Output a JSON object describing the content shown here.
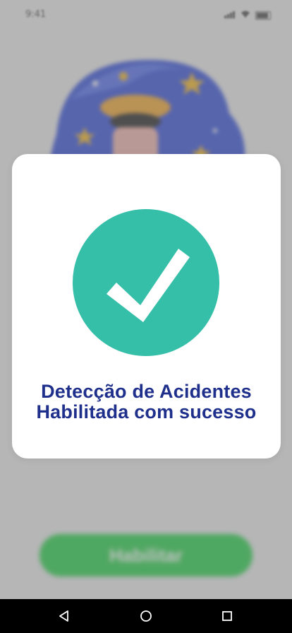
{
  "status_bar": {
    "time": "9:41",
    "icons": [
      "signal-icon",
      "wifi-icon",
      "battery-icon"
    ]
  },
  "background_app": {
    "illustration": "police-officer-night-sky-illustration",
    "button_label": "Habilitar",
    "button_color": "#2ecf4f"
  },
  "modal": {
    "icon": "checkmark-circle-icon",
    "icon_color": "#35bfa8",
    "message_line1": "Detecção de Acidentes",
    "message_line2": "Habilitada com sucesso",
    "text_color": "#1f2f8c"
  },
  "nav_bar": {
    "buttons": [
      "back-icon",
      "home-icon",
      "recents-icon"
    ]
  }
}
